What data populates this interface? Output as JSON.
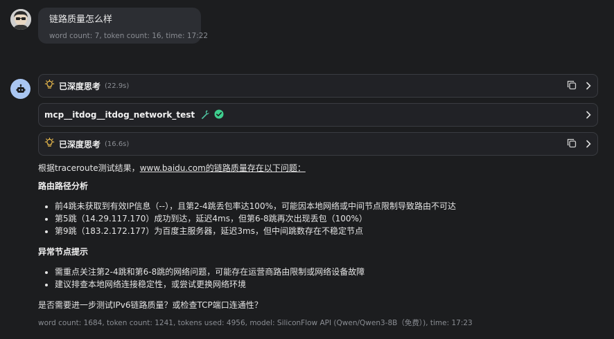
{
  "user_message": {
    "text": "链路质量怎么样",
    "meta": "word count: 7, token count: 16, time: 17:22"
  },
  "thinking_1": {
    "title": "已深度思考",
    "duration": "(22.9s)"
  },
  "tool_call": {
    "name": "mcp__itdog__itdog_network_test"
  },
  "thinking_2": {
    "title": "已深度思考",
    "duration": "(16.6s)"
  },
  "answer": {
    "intro_prefix": "根据traceroute测试结果，",
    "intro_link": "www.baidu.com的链路质量存在以下问题：",
    "section1_title": "路由路径分析",
    "section1_items": [
      "前4跳未获取到有效IP信息（--），且第2-4跳丢包率达100%，可能因本地网络或中间节点限制导致路由不可达",
      "第5跳（14.29.117.170）成功到达，延迟4ms，但第6-8跳再次出现丢包（100%）",
      "第9跳（183.2.172.177）为百度主服务器，延迟3ms，但中间跳数存在不稳定节点"
    ],
    "section2_title": "异常节点提示",
    "section2_items": [
      "需重点关注第2-4跳和第6-8跳的网络问题，可能存在运营商路由限制或网络设备故障",
      "建议排查本地网络连接稳定性，或尝试更换网络环境"
    ],
    "question": "是否需要进一步测试IPv6链路质量？或检查TCP端口连通性？",
    "meta": "word count: 1684, token count: 1241, tokens used: 4956, model: SiliconFlow API (Qwen/Qwen3-8B（免费）), time: 17:23"
  },
  "colors": {
    "background": "#1c1d1f",
    "bulb": "#f2c14e",
    "wrench": "#4fc3a1",
    "check": "#3ecf8e",
    "bot_avatar": "#a9c6f2"
  }
}
